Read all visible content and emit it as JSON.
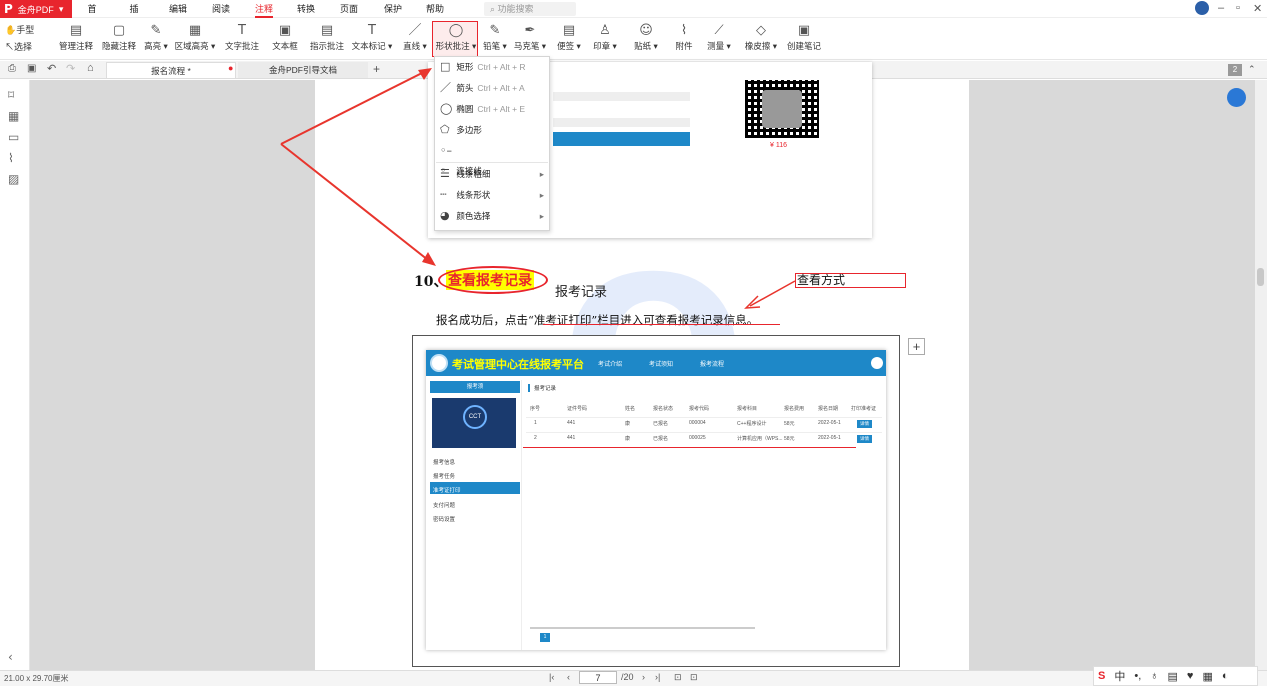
{
  "app": {
    "brand": "金舟PDF",
    "menu": [
      "首页",
      "插入",
      "编辑",
      "阅读",
      "注释",
      "转换",
      "页面",
      "保护",
      "帮助"
    ],
    "active_menu": "注释",
    "search_placeholder": "功能搜索"
  },
  "toolbar": {
    "hand": "手型",
    "select": "选择",
    "buttons": [
      "管理注释",
      "隐藏注释",
      "高亮 ▾",
      "区域高亮 ▾",
      "文字批注",
      "文本框",
      "指示批注",
      "文本标记 ▾",
      "直线 ▾",
      "形状批注 ▾",
      "铅笔 ▾",
      "马克笔 ▾",
      "便签 ▾",
      "印章 ▾",
      "贴纸 ▾",
      "附件",
      "测量 ▾",
      "橡皮擦 ▾",
      "创建笔记"
    ]
  },
  "tabs": {
    "tab1": "报名流程 *",
    "tab2": "金舟PDF引导文档",
    "add": "+"
  },
  "shape_menu": [
    {
      "icon": "rect-icon",
      "label": "矩形",
      "key": "Ctrl + Alt + R"
    },
    {
      "icon": "arrow-icon",
      "label": "箭头",
      "key": "Ctrl + Alt + A"
    },
    {
      "icon": "ellipse-icon",
      "label": "椭圆",
      "key": "Ctrl + Alt + E"
    },
    {
      "icon": "polygon-icon",
      "label": "多边形",
      "key": ""
    },
    {
      "icon": "connector-icon",
      "label": "连接线",
      "key": ""
    },
    {
      "icon": "line-weight-icon",
      "label": "线条粗细",
      "key": ""
    },
    {
      "icon": "line-style-icon",
      "label": "线条形状",
      "key": ""
    },
    {
      "icon": "color-icon",
      "label": "颜色选择",
      "key": ""
    }
  ],
  "doc": {
    "price": "¥ 116",
    "h10": "10、",
    "highlight": "查看报考记录",
    "subtitle": "报考记录",
    "note": "查看方式",
    "paragraph": "报名成功后，点击“准考证打印”栏目进入可查看报考记录信息。"
  },
  "shot": {
    "title": "考试管理中心在线报考平台",
    "nav": [
      "考试介绍",
      "考试须知",
      "报考流程"
    ],
    "side_head": "报考须",
    "side_items": [
      "报考信息",
      "报考任务",
      "准考证打印",
      "支付问题",
      "密码设置"
    ],
    "section": "报考记录",
    "headers": [
      "序号",
      "证件号码",
      "姓名",
      "报名状态",
      "报考代码",
      "报考科目",
      "报名费用",
      "报名日期",
      "打印准考证"
    ],
    "rows": [
      [
        "1",
        "441",
        "康",
        "已报名",
        "000004",
        "C++程序设计",
        "58元",
        "2022-05-1",
        "详情"
      ],
      [
        "2",
        "441",
        "康",
        "已报名",
        "000025",
        "计算机应用（WPS...",
        "58元",
        "2022-05-1",
        "详情"
      ]
    ]
  },
  "status": {
    "size": "21.00 x 29.70厘米",
    "page": "7",
    "total": "/20",
    "page_badge": "2"
  },
  "ime": {
    "zh": "中"
  }
}
